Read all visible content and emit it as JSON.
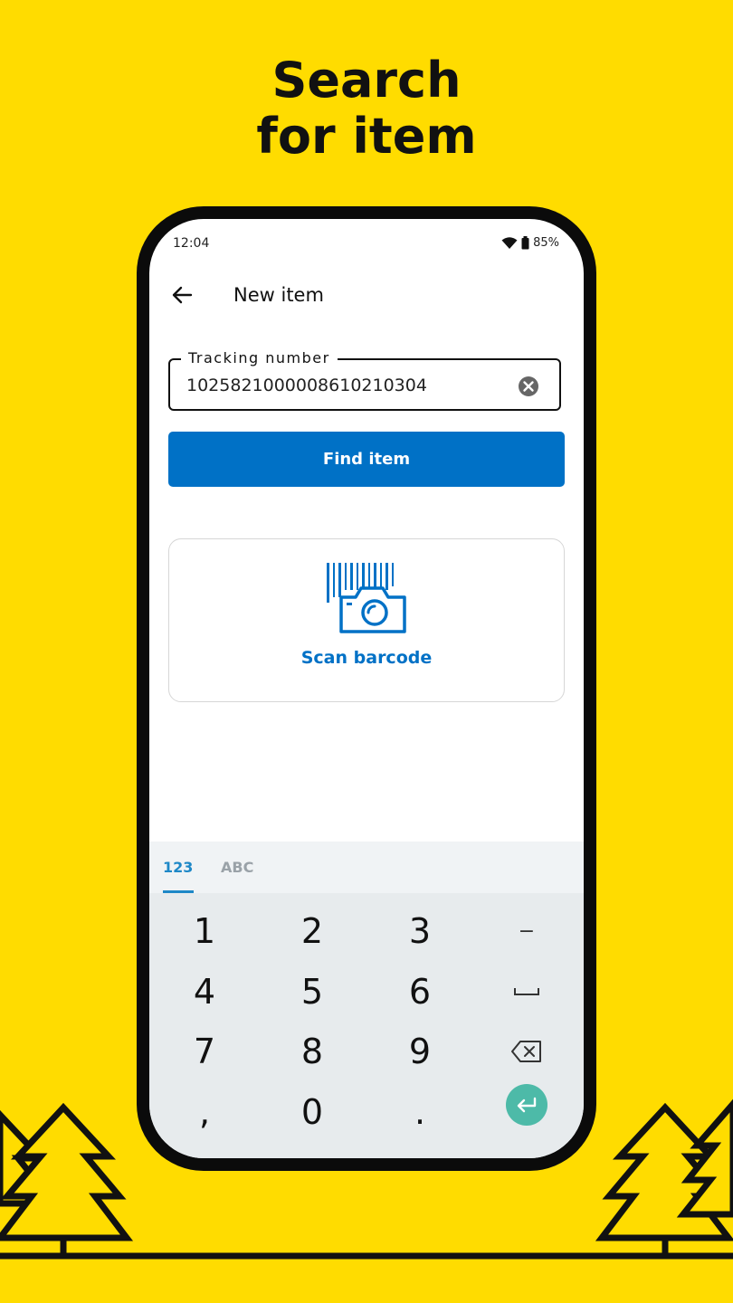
{
  "promo": {
    "headline_line1": "Search",
    "headline_line2": "for item"
  },
  "status_bar": {
    "time": "12:04",
    "battery": "85%"
  },
  "app_bar": {
    "title": "New item"
  },
  "tracking_field": {
    "label": "Tracking number",
    "value": "102582100000861021030​4"
  },
  "find_button": {
    "label": "Find item"
  },
  "scan": {
    "label": "Scan barcode"
  },
  "keyboard": {
    "tabs": [
      "123",
      "ABC"
    ],
    "active_tab": "123",
    "keys": {
      "k1": "1",
      "k2": "2",
      "k3": "3",
      "minus": "−",
      "k4": "4",
      "k5": "5",
      "k6": "6",
      "k7": "7",
      "k8": "8",
      "k9": "9",
      "comma": ",",
      "k0": "0",
      "dot": "."
    },
    "icons": {
      "space": "space-icon",
      "backspace": "backspace-icon",
      "enter": "enter-icon"
    }
  },
  "colors": {
    "background": "#FFDC00",
    "primary": "#0071C6",
    "enter_key": "#4DBAA8",
    "active_tab": "#1E88C7"
  }
}
